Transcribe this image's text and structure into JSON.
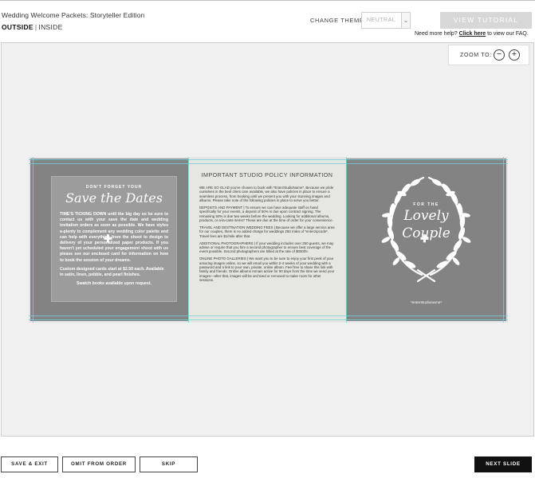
{
  "header": {
    "title": "Wedding Welcome Packets: Storyteller Edition",
    "view_outside": "OUTSIDE",
    "view_separator": "|",
    "view_inside": "INSIDE",
    "theme_label": "CHANGE THEME:",
    "theme_value": "NEUTRAL",
    "tutorial_label": "VIEW TUTORIAL",
    "help_prefix": "Need more help?",
    "help_link": "Click here",
    "help_suffix": "to view our FAQ."
  },
  "zoom": {
    "label": "ZOOM TO:",
    "minus": "−",
    "plus": "+"
  },
  "left_panel": {
    "kicker": "DON'T FORGET YOUR",
    "script": "Save the Dates",
    "body": "TIME'S TICKING DOWN until the big day so be sure to contact us with your save the date and wedding invitation orders as soon as possible. We have styles a-plenty to complement any wedding color palette and can help with everything from the shoot to design to delivery of your personalized paper products. If you haven't yet scheduled your engagement shoot with us please see our enclosed card for information on how to book the session of your dreams.",
    "price": "Custom designed cards start at $2.50 each. Available in satin, linen, pebble, and pearl finishes.",
    "swatch": "Swatch books available upon request."
  },
  "middle_panel": {
    "title": "IMPORTANT STUDIO POLICY INFORMATION",
    "paragraphs": [
      "WE ARE SO GLAD you've chosen to book with *EnterStudioName*. Because we pride ourselves in the best client care available, we also have policies in place to ensure a seamless process, from booking until we present you with your stunning images and albums. Please take note of the following policies in place to serve you better.",
      "DEPOSITS AND PAYMENT | To ensure we can have adequate staff on hand specifically for your events, a deposit of 50% is due upon contract signing. The remaining 50% is due two weeks before the wedding. Looking for additional albums, products, or a-la-carte items? These are due at the time of order for your convenience.",
      "TRAVEL AND DESTINATION WEDDING FEES | Because we offer a large service area for our couples, there is no added charge for weddings 250 miles of *enterzipcode*. Travel fees are $1/mile after that.",
      "ADDITIONAL PHOTOGRAPHERS | If your wedding includes over 250 guests, we may advise or require that you hire a second photographer to ensure best coverage of the event possible. Second photographers are billed at the rate of $000/hr.",
      "ONLINE PHOTO GALLERIES | We want you to be sure to enjoy your first peek of your amazing images online, so we will email you within 2-4 weeks of your wedding with a password and a link to your own, private, online album. Feel free to share this link with family and friends. Online albums remain active for 90 days from the time we send your images—after that, images will be archived or removed to make room for other sessions."
    ]
  },
  "right_panel": {
    "for_the": "FOR THE",
    "lovely": "Lovely",
    "couple": "Couple",
    "studio": "*enterstudioname*"
  },
  "footer": {
    "save_exit": "SAVE & EXIT",
    "omit": "OMIT FROM ORDER",
    "skip": "SKIP",
    "next": "NEXT SLIDE"
  },
  "colors": {
    "panel_gray": "#838383",
    "card_gray": "#9c9c9c",
    "middle_bg": "#e7e7e1",
    "guide": "#6fd0d8",
    "tutorial_btn": "#d7d7d7",
    "next_btn": "#111111"
  },
  "icons": [
    "chevron-down-icon",
    "zoom-out-icon",
    "zoom-in-icon",
    "move-icon",
    "laurel-wreath-icon"
  ]
}
